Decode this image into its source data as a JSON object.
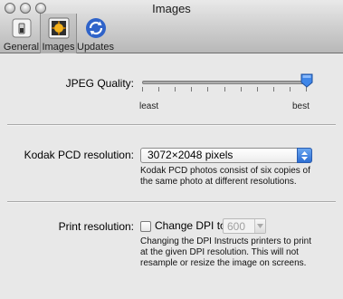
{
  "window": {
    "title": "Images"
  },
  "toolbar": {
    "tabs": [
      {
        "label": "General",
        "icon": "switch-icon",
        "selected": false
      },
      {
        "label": "Images",
        "icon": "photo-icon",
        "selected": true
      },
      {
        "label": "Updates",
        "icon": "sync-icon",
        "selected": false
      }
    ]
  },
  "jpeg": {
    "label": "JPEG Quality:",
    "min_label": "least",
    "max_label": "best",
    "value": 1.0
  },
  "kodak": {
    "label": "Kodak PCD resolution:",
    "selected": "3072×2048 pixels",
    "help_line1": "Kodak PCD photos consist of six copies of",
    "help_line2": "the same photo at different resolutions."
  },
  "print": {
    "label": "Print resolution:",
    "checkbox_label": "Change DPI to",
    "checked": false,
    "dpi_value": "600",
    "help_line1": "Changing the DPI Instructs printers to print",
    "help_line2": "at the given DPI resolution. This will not",
    "help_line3": "resample or resize the image on screens."
  },
  "colors": {
    "accent": "#2d6ed3",
    "thumb": "#3f86e8"
  }
}
